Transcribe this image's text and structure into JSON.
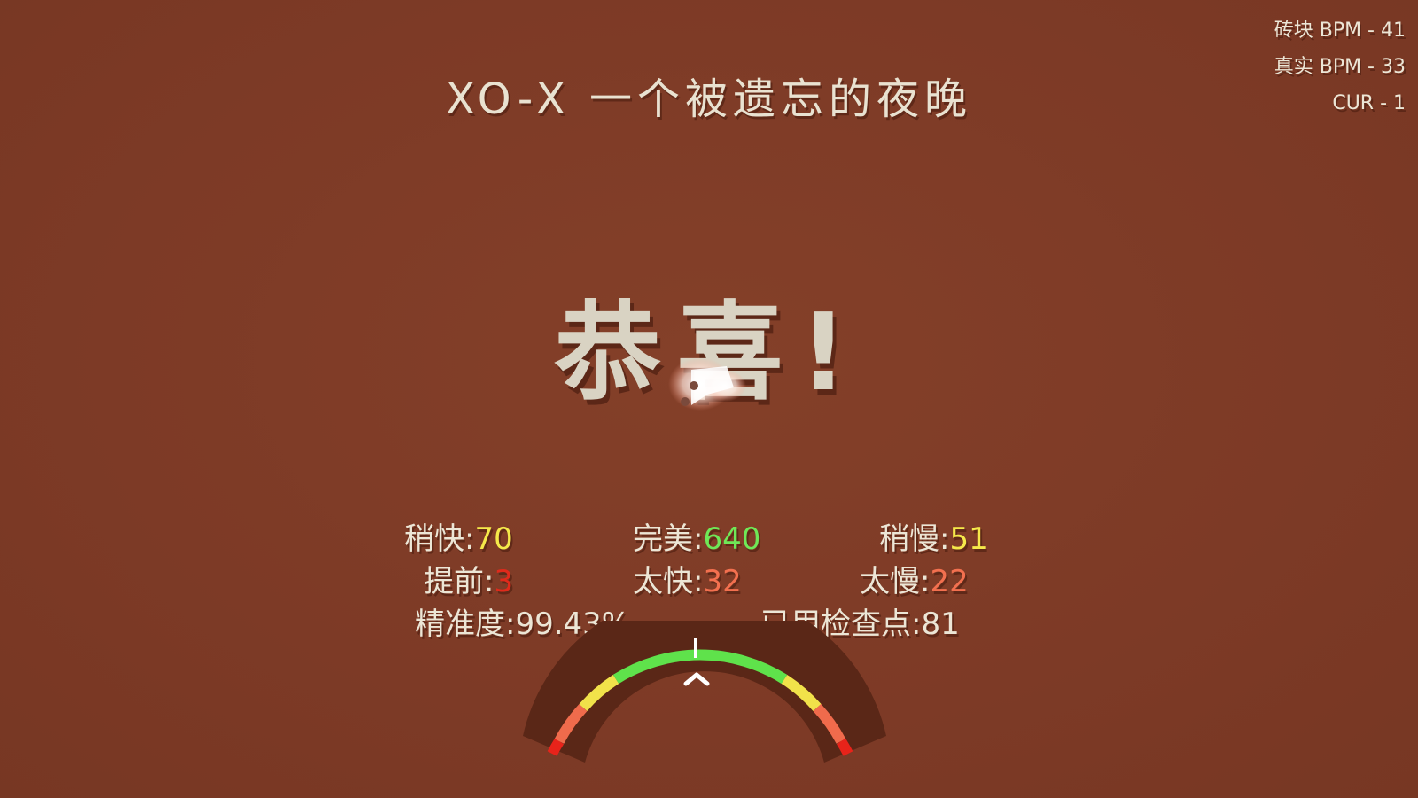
{
  "title": "XO-X 一个被遗忘的夜晚",
  "hud": {
    "tile_bpm": "砖块 BPM - 41",
    "real_bpm": "真实 BPM - 33",
    "cur": "CUR - 1"
  },
  "result_text": "恭喜!",
  "stats": {
    "early": {
      "label": "稍快:",
      "value": "70"
    },
    "perfect": {
      "label": "完美:",
      "value": "640"
    },
    "late": {
      "label": "稍慢:",
      "value": "51"
    },
    "too_early": {
      "label": "提前:",
      "value": "3"
    },
    "very_early": {
      "label": "太快:",
      "value": "32"
    },
    "very_late": {
      "label": "太慢:",
      "value": "22"
    },
    "accuracy": {
      "label": "精准度:",
      "value": "99.43%"
    },
    "checkpoints": {
      "label": "已用检查点:",
      "value": "81"
    }
  },
  "colors": {
    "background": "#7f3c27",
    "text": "#ece6d6",
    "yellow": "#f5e94a",
    "green": "#6fe857",
    "red": "#e02a1b",
    "orange": "#f3704f",
    "gauge_track": "#5a2717"
  },
  "icons": {
    "planet": "planet-icon",
    "gauge": "timing-gauge",
    "gauge_pointer": "chevron-up-icon"
  }
}
